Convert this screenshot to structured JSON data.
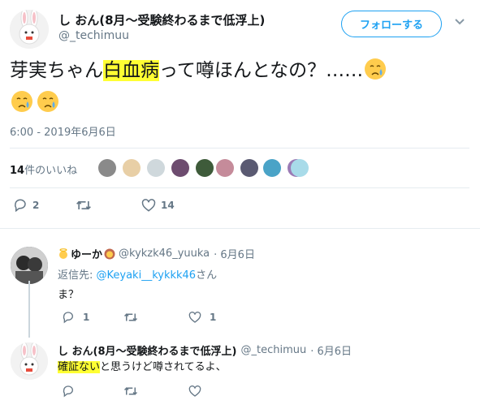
{
  "tweet": {
    "display_name": "し おん(8月～受験終わるまで低浮上)",
    "handle": "@_techimuu",
    "follow_label": "フォローする",
    "text_before": "芽実ちゃん",
    "text_highlight": "白血病",
    "text_after": "って噂ほんとなの？……",
    "timestamp": "6:00 - 2019年6月6日",
    "likes_number": "14",
    "likes_suffix": "件のいいね",
    "reply_count": "2",
    "retweet_count": "",
    "like_count": "14"
  },
  "replies": [
    {
      "display_name": "ゆーか",
      "handle": "@kykzk46_yuuka",
      "date": "· 6月6日",
      "reply_to_prefix": "返信先: ",
      "reply_to_handle": "@Keyaki__kykkk46",
      "reply_to_suffix": "さん",
      "text": "ま？",
      "reply_count": "1",
      "like_count": "1"
    },
    {
      "display_name": "し おん(8月～受験終わるまで低浮上)",
      "handle": "@_techimuu",
      "date": "· 6月6日",
      "text_highlight": "確証ない",
      "text_after": "と思うけど噂されてるよ、"
    }
  ],
  "colors": {
    "accent": "#1da1f2",
    "highlight": "#ffff33",
    "muted": "#657786"
  }
}
